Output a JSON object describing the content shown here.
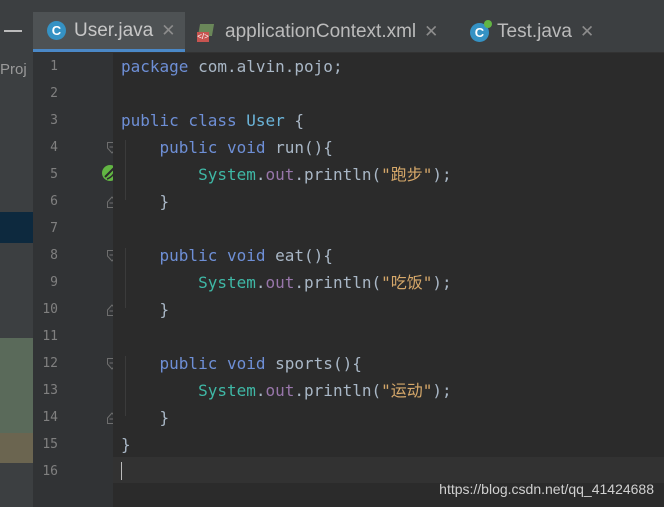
{
  "sidebar": {
    "label": "Proj"
  },
  "tabs": [
    {
      "label": "User.java",
      "icon": "java-class-icon",
      "active": true
    },
    {
      "label": "applicationContext.xml",
      "icon": "xml-file-icon",
      "active": false
    },
    {
      "label": "Test.java",
      "icon": "java-test-class-icon",
      "active": false
    }
  ],
  "editor": {
    "line_numbers": [
      "1",
      "2",
      "3",
      "4",
      "5",
      "6",
      "7",
      "8",
      "9",
      "10",
      "11",
      "12",
      "13",
      "14",
      "15",
      "16"
    ],
    "package_keyword": "package",
    "package_name": "com.alvin.pojo;",
    "class_keyword": "public class",
    "class_name": "User",
    "class_open": "{",
    "methods": [
      {
        "mod": "public void",
        "name": "run(){",
        "sys": "System",
        "dot1": ".",
        "out": "out",
        "call": ".println(",
        "str": "\"跑步\"",
        "end": ");",
        "close": "}"
      },
      {
        "mod": "public void",
        "name": "eat(){",
        "sys": "System",
        "dot1": ".",
        "out": "out",
        "call": ".println(",
        "str": "\"吃饭\"",
        "end": ");",
        "close": "}"
      },
      {
        "mod": "public void",
        "name": "sports(){",
        "sys": "System",
        "dot1": ".",
        "out": "out",
        "call": ".println(",
        "str": "\"运动\"",
        "end": ");",
        "close": "}"
      }
    ],
    "class_close": "}"
  },
  "watermark": "https://blog.csdn.net/qq_41424688",
  "colors": {
    "keyword": "#cc7832",
    "string": "#6a8759",
    "background": "#2b2b2b",
    "gutter": "#313335"
  }
}
